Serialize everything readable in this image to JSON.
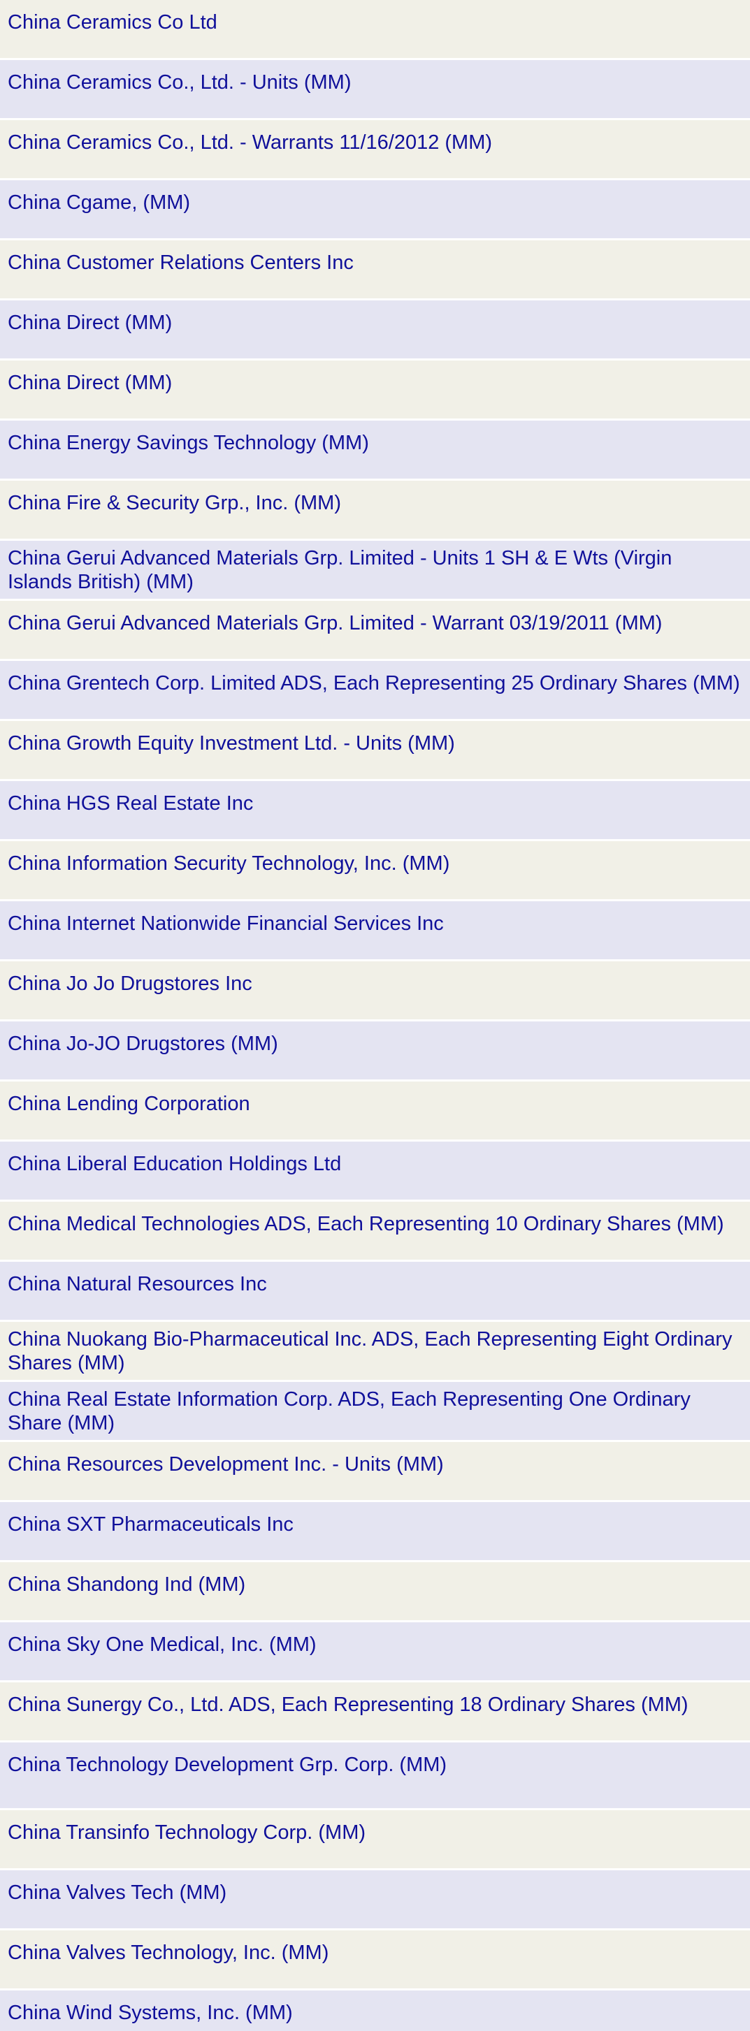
{
  "listings": [
    {
      "name": "China Ceramics Co Ltd"
    },
    {
      "name": "China Ceramics Co., Ltd. - Units (MM)"
    },
    {
      "name": "China Ceramics Co., Ltd. - Warrants 11/16/2012 (MM)"
    },
    {
      "name": "China Cgame, (MM)"
    },
    {
      "name": "China Customer Relations Centers Inc"
    },
    {
      "name": "China Direct (MM)"
    },
    {
      "name": "China Direct (MM)"
    },
    {
      "name": "China Energy Savings Technology (MM)"
    },
    {
      "name": "China Fire & Security Grp., Inc. (MM)"
    },
    {
      "name": "China Gerui Advanced Materials Grp. Limited - Units 1 SH & E Wts (Virgin Islands British) (MM)"
    },
    {
      "name": "China Gerui Advanced Materials Grp. Limited - Warrant 03/19/2011 (MM)"
    },
    {
      "name": "China Grentech Corp. Limited ADS, Each Representing 25 Ordinary Shares (MM)"
    },
    {
      "name": "China Growth Equity Investment Ltd. - Units (MM)"
    },
    {
      "name": "China HGS Real Estate Inc"
    },
    {
      "name": "China Information Security Technology, Inc. (MM)"
    },
    {
      "name": "China Internet Nationwide Financial Services Inc"
    },
    {
      "name": "China Jo Jo Drugstores Inc"
    },
    {
      "name": "China Jo-JO Drugstores (MM)"
    },
    {
      "name": "China Lending Corporation"
    },
    {
      "name": "China Liberal Education Holdings Ltd"
    },
    {
      "name": "China Medical Technologies ADS, Each Representing 10 Ordinary Shares (MM)"
    },
    {
      "name": "China Natural Resources Inc"
    },
    {
      "name": "China Nuokang Bio-Pharmaceutical Inc. ADS, Each Representing Eight Ordinary Shares (MM)"
    },
    {
      "name": "China Real Estate Information Corp. ADS, Each Representing One Ordinary Share (MM)"
    },
    {
      "name": "China Resources Development Inc. - Units (MM)"
    },
    {
      "name": "China SXT Pharmaceuticals Inc"
    },
    {
      "name": "China Shandong Ind (MM)"
    },
    {
      "name": "China Sky One Medical, Inc. (MM)"
    },
    {
      "name": "China Sunergy Co., Ltd. ADS, Each Representing 18 Ordinary Shares (MM)"
    },
    {
      "name": "China Technology Development Grp. Corp. (MM)"
    },
    {
      "name": "China Transinfo Technology Corp. (MM)"
    },
    {
      "name": "China Valves Tech (MM)"
    },
    {
      "name": "China Valves Technology, Inc. (MM)"
    },
    {
      "name": "China Wind Systems, Inc. (MM)"
    }
  ]
}
